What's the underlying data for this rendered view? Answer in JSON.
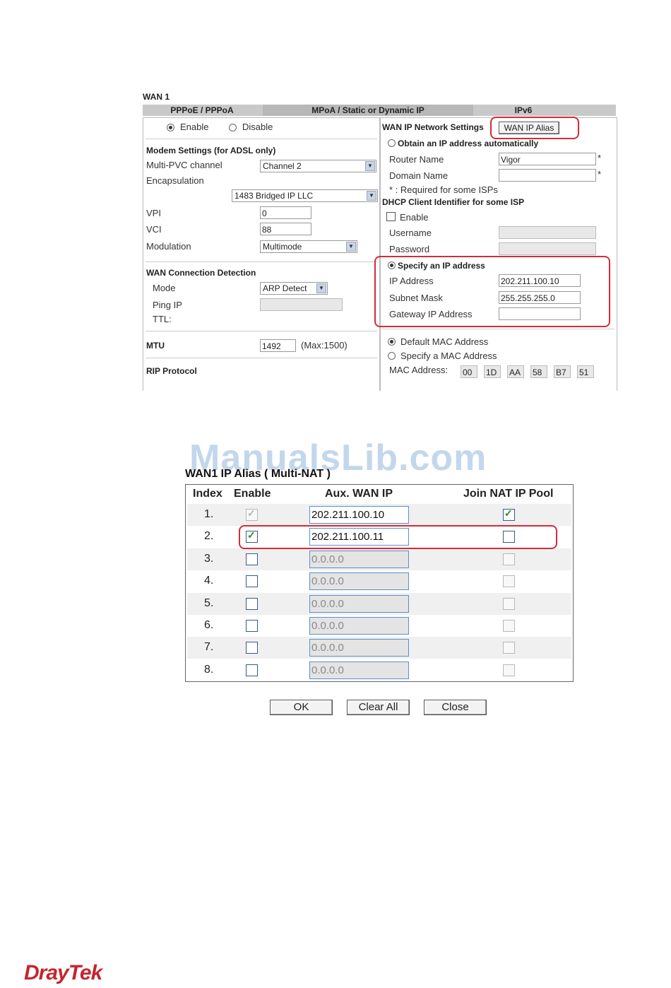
{
  "wan": {
    "title": "WAN 1",
    "tabs": [
      "PPPoE / PPPoA",
      "MPoA / Static or Dynamic IP",
      "IPv6"
    ],
    "enable_label": "Enable",
    "disable_label": "Disable",
    "modem_heading": "Modem Settings (for ADSL only)",
    "multi_pvc_label": "Multi-PVC channel",
    "multi_pvc_value": "Channel 2",
    "encapsulation_label": "Encapsulation",
    "encapsulation_value": "1483 Bridged IP LLC",
    "vpi_label": "VPI",
    "vpi_value": "0",
    "vci_label": "VCI",
    "vci_value": "88",
    "modulation_label": "Modulation",
    "modulation_value": "Multimode",
    "detect_heading": "WAN Connection Detection",
    "mode_label": "Mode",
    "mode_value": "ARP Detect",
    "ping_ip_label": "Ping IP",
    "ttl_label": "TTL:",
    "mtu_label": "MTU",
    "mtu_value": "1492",
    "mtu_max": "(Max:1500)",
    "rip_label": "RIP Protocol",
    "ipnet_heading": "WAN IP Network Settings",
    "ip_alias_button": "WAN IP Alias",
    "obtain_auto_label": "Obtain an IP address automatically",
    "router_name_label": "Router Name",
    "router_name_value": "Vigor",
    "domain_name_label": "Domain Name",
    "required_note": "* : Required for some ISPs",
    "dhcp_heading": "DHCP Client Identifier for some ISP",
    "dhcp_enable_label": "Enable",
    "username_label": "Username",
    "password_label": "Password",
    "specify_ip_label": "Specify an IP address",
    "ip_address_label": "IP Address",
    "ip_address_value": "202.211.100.10",
    "subnet_label": "Subnet Mask",
    "subnet_value": "255.255.255.0",
    "gateway_label": "Gateway IP Address",
    "default_mac_label": "Default MAC Address",
    "specify_mac_label": "Specify a MAC Address",
    "mac_label": "MAC Address:",
    "mac_octets": [
      "00",
      "1D",
      "AA",
      "58",
      "B7",
      "51"
    ]
  },
  "watermark": "ManualsLib.com",
  "alias": {
    "title": "WAN1 IP Alias ( Multi-NAT )",
    "headers": [
      "Index",
      "Enable",
      "Aux. WAN IP",
      "Join NAT IP Pool"
    ],
    "rows": [
      {
        "index": "1.",
        "ip": "202.211.100.10",
        "enable": true,
        "join": true
      },
      {
        "index": "2.",
        "ip": "202.211.100.11",
        "enable": true,
        "join": false
      },
      {
        "index": "3.",
        "ip": "0.0.0.0",
        "enable": false,
        "join": false
      },
      {
        "index": "4.",
        "ip": "0.0.0.0",
        "enable": false,
        "join": false
      },
      {
        "index": "5.",
        "ip": "0.0.0.0",
        "enable": false,
        "join": false
      },
      {
        "index": "6.",
        "ip": "0.0.0.0",
        "enable": false,
        "join": false
      },
      {
        "index": "7.",
        "ip": "0.0.0.0",
        "enable": false,
        "join": false
      },
      {
        "index": "8.",
        "ip": "0.0.0.0",
        "enable": false,
        "join": false
      }
    ],
    "buttons": {
      "ok": "OK",
      "clear": "Clear All",
      "close": "Close"
    }
  },
  "brand": "DrayTek",
  "colors": {
    "highlight": "#d62a3a",
    "check": "#1f8f1f",
    "brand": "#c3262f"
  }
}
